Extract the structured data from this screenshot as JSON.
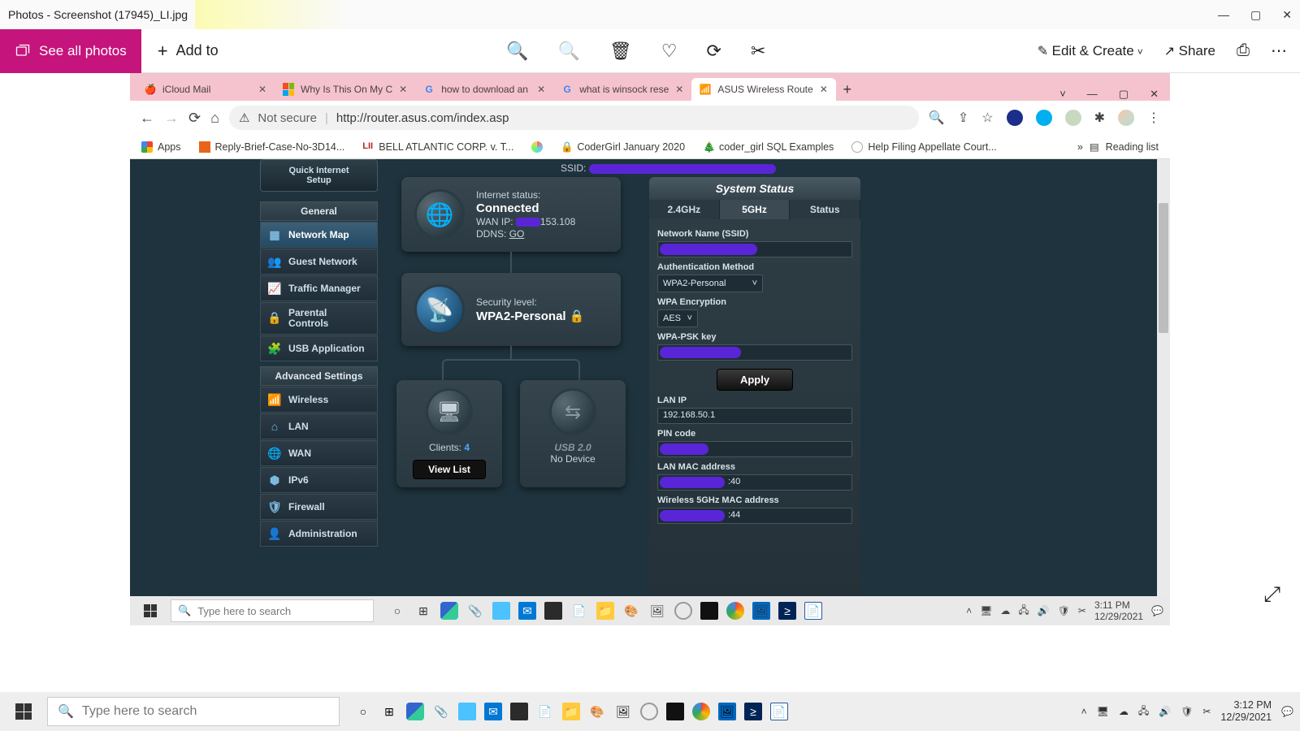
{
  "photos": {
    "title": "Photos - Screenshot (17945)_LI.jpg",
    "see_all": "See all photos",
    "add_to": "Add to",
    "edit_create": "Edit & Create",
    "share": "Share"
  },
  "browser": {
    "tabs": [
      {
        "label": "iCloud Mail"
      },
      {
        "label": "Why Is This On My C"
      },
      {
        "label": "how to download an"
      },
      {
        "label": "what is winsock rese"
      },
      {
        "label": "ASUS Wireless Route"
      }
    ],
    "not_secure": "Not secure",
    "url": "http://router.asus.com/index.asp",
    "bookmarks": {
      "apps": "Apps",
      "b1": "Reply-Brief-Case-No-3D14...",
      "b2": "BELL ATLANTIC CORP. v. T...",
      "b3": "CoderGirl January 2020",
      "b4": "coder_girl SQL Examples",
      "b5": "Help Filing Appellate Court...",
      "reading": "Reading list"
    }
  },
  "router": {
    "ssid_label": "SSID:",
    "qis_line1": "Quick Internet",
    "qis_line2": "Setup",
    "section_general": "General",
    "section_advanced": "Advanced Settings",
    "nav": {
      "netmap": "Network Map",
      "guest": "Guest Network",
      "traffic": "Traffic Manager",
      "parental1": "Parental",
      "parental2": "Controls",
      "usb": "USB Application",
      "wireless": "Wireless",
      "lan": "LAN",
      "wan": "WAN",
      "ipv6": "IPv6",
      "firewall": "Firewall",
      "admin": "Administration"
    },
    "internet": {
      "status_label": "Internet status:",
      "status_val": "Connected",
      "wanip_label": "WAN IP:",
      "wanip_suffix": "153.108",
      "ddns_label": "DDNS:",
      "ddns_val": "GO"
    },
    "security": {
      "label": "Security level:",
      "val": "WPA2-Personal"
    },
    "clients": {
      "label": "Clients:",
      "count": "4",
      "viewlist": "View List"
    },
    "usb": {
      "title": "USB 2.0",
      "nodev": "No Device"
    },
    "status": {
      "title": "System Status",
      "tab24": "2.4GHz",
      "tab5": "5GHz",
      "tabstatus": "Status",
      "ssid_lab": "Network Name (SSID)",
      "auth_lab": "Authentication Method",
      "auth_val": "WPA2-Personal",
      "enc_lab": "WPA Encryption",
      "enc_val": "AES",
      "psk_lab": "WPA-PSK key",
      "apply": "Apply",
      "lanip_lab": "LAN IP",
      "lanip_val": "192.168.50.1",
      "pin_lab": "PIN code",
      "lanmac_lab": "LAN MAC address",
      "lanmac_suffix": ":40",
      "w5mac_lab": "Wireless 5GHz MAC address",
      "w5mac_suffix": ":44"
    }
  },
  "inner_taskbar": {
    "search_placeholder": "Type here to search",
    "time": "3:11 PM",
    "date": "12/29/2021"
  },
  "outer_taskbar": {
    "search_placeholder": "Type here to search",
    "time": "3:12 PM",
    "date": "12/29/2021"
  }
}
